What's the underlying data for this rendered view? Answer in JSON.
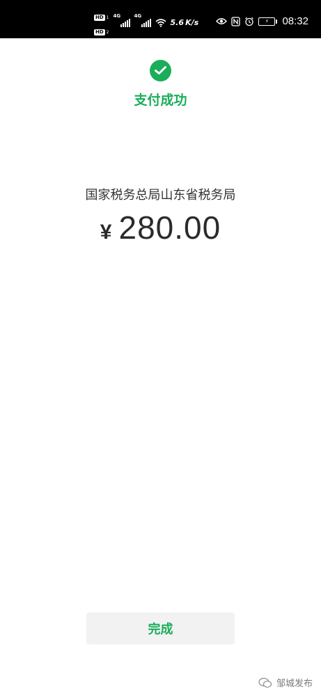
{
  "status_bar": {
    "hd1": "HD",
    "hd1_sim": "1",
    "hd2": "HD",
    "hd2_sim": "2",
    "net1": "4G",
    "net2": "4G",
    "extra": "5.6 K/s",
    "time": "08:32",
    "icons": [
      "eye-icon",
      "nfc-icon",
      "alarm-icon",
      "battery-icon",
      "wifi-icon"
    ]
  },
  "success": {
    "title": "支付成功",
    "icon": "check-icon",
    "color": "#1aad5a"
  },
  "payment": {
    "merchant": "国家税务总局山东省税务局",
    "currency": "¥",
    "amount": "280.00"
  },
  "actions": {
    "done_label": "完成"
  },
  "watermark": {
    "text": "邹城发布",
    "icon": "wechat-icon"
  }
}
